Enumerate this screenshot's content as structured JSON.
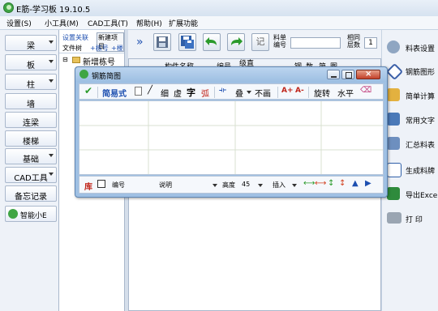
{
  "window": {
    "title": "E筋-学习板 19.10.5"
  },
  "menu": [
    "设置(S)",
    "小工具(M)",
    "CAD工具(T)",
    "帮助(H)",
    "扩展功能"
  ],
  "sidebar": {
    "items": [
      {
        "label": "梁",
        "dropdown": true
      },
      {
        "label": "板",
        "dropdown": true
      },
      {
        "label": "柱",
        "dropdown": true
      },
      {
        "label": "墙",
        "dropdown": false
      },
      {
        "label": "连梁",
        "dropdown": false
      },
      {
        "label": "楼梯",
        "dropdown": false
      },
      {
        "label": "基础",
        "dropdown": true
      },
      {
        "label": "CAD工具",
        "dropdown": true
      },
      {
        "label": "备忘记录",
        "dropdown": false
      }
    ],
    "smart_label": "智能小E"
  },
  "tree": {
    "settings_link": "设置关联",
    "new_item": "新建项目",
    "file_tree": "文件树",
    "add_floor": "+栋号",
    "add_more": "+楼",
    "root_node": "新增栋号",
    "expand": "⊟"
  },
  "toolbar": {
    "expand": "»",
    "save": "保存",
    "record": "记",
    "sheet_no_label": "料单编号",
    "floors_label": "相同层数",
    "floors_value": "1",
    "sheet_no_value": ""
  },
  "table": {
    "headers": [
      "构件名称",
      "编号",
      "级直",
      "钢",
      "数",
      "简",
      "图"
    ]
  },
  "rightpanel": [
    {
      "label": "料表设置",
      "icon": "gear-icon"
    },
    {
      "label": "钢筋图形",
      "icon": "shape-icon"
    },
    {
      "label": "简单计算",
      "icon": "calc-icon"
    },
    {
      "label": "常用文字",
      "icon": "text-icon"
    },
    {
      "label": "汇总料表",
      "icon": "sum-icon"
    },
    {
      "label": "生成料牌",
      "icon": "label-icon"
    },
    {
      "label": "导出Excel",
      "icon": "excel-icon"
    },
    {
      "label": "打 印",
      "icon": "printer-icon"
    }
  ],
  "dialog": {
    "title": "钢筋简图",
    "toolbar": {
      "confirm": "✔",
      "simple_mode": "简易式",
      "line": "╱",
      "thin": "细",
      "dashed": "虚",
      "char": "字",
      "arc": "弧",
      "rebar_sym": "⟛",
      "overlay": "叠",
      "no_draw": "不画",
      "font_bigger": "A+",
      "font_smaller": "A-",
      "rotate": "旋转",
      "horizontal": "水平",
      "eraser": "⌫"
    },
    "bottom": {
      "library": "库",
      "number_label": "编号",
      "desc_label": "说明",
      "height_label": "高度",
      "height_value": "45",
      "insert_label": "插入"
    }
  },
  "colors": {
    "accent": "#1d4fb0",
    "save_green": "#2a9a2a",
    "red": "#c0261b"
  }
}
